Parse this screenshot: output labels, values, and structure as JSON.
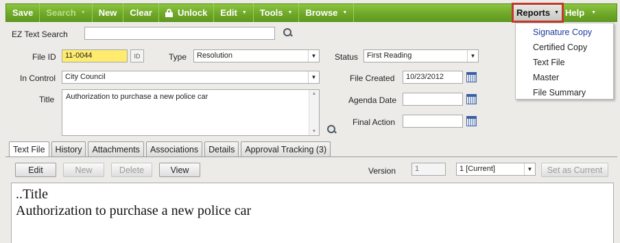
{
  "toolbar": {
    "save": "Save",
    "search": "Search",
    "new": "New",
    "clear": "Clear",
    "unlock": "Unlock",
    "edit": "Edit",
    "tools": "Tools",
    "browse": "Browse",
    "reports": "Reports",
    "help": "Help"
  },
  "reports_menu": [
    "Signature Copy",
    "Certified Copy",
    "Text File",
    "Master",
    "File Summary"
  ],
  "form": {
    "ez_search_label": "EZ Text Search",
    "ez_search_value": "",
    "file_id_label": "File ID",
    "file_id_value": "11-0044",
    "id_button": "ID",
    "type_label": "Type",
    "type_value": "Resolution",
    "status_label": "Status",
    "status_value": "First Reading",
    "in_control_label": "In Control",
    "in_control_value": "City Council",
    "file_created_label": "File Created",
    "file_created_value": "10/23/2012",
    "title_label": "Title",
    "title_value": "Authorization to purchase a new police car",
    "agenda_date_label": "Agenda Date",
    "agenda_date_value": "",
    "final_action_label": "Final Action",
    "final_action_value": ""
  },
  "tabs": [
    "Text File",
    "History",
    "Attachments",
    "Associations",
    "Details",
    "Approval Tracking (3)"
  ],
  "textfile": {
    "edit": "Edit",
    "new": "New",
    "delete": "Delete",
    "view": "View",
    "version_label": "Version",
    "version_value": "1",
    "version_select": "1 [Current]",
    "set_current": "Set as Current",
    "body_line1": "..Title",
    "body_line2": "Authorization to purchase a new police car"
  }
}
